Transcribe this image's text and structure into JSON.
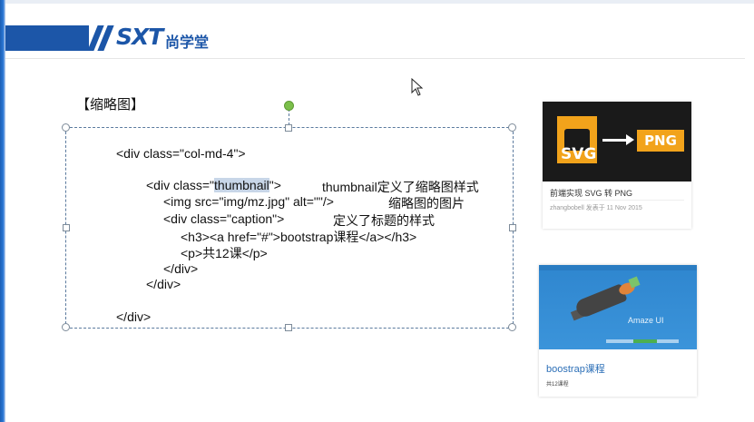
{
  "header": {
    "logo_text": "SXT",
    "logo_cn": "尚学堂"
  },
  "slide": {
    "section_title": "【缩略图】",
    "code": {
      "line1": "<div class=\"col-md-4\">",
      "line2_pre": "<div class=\"",
      "line2_hl": "thumbnail",
      "line2_post": "\">",
      "line2_note": "thumbnail定义了缩略图样式",
      "line3": "<img src=\"img/mz.jpg\" alt=\"\"/>",
      "line3_note": "缩略图的图片",
      "line4": "<div class=\"caption\">",
      "line4_note": "定义了标题的样式",
      "line5": "<h3><a href=\"#\">bootstrap课程</a></h3>",
      "line6": "<p>共12课</p>",
      "line7": "</div>",
      "line8": "</div>",
      "line9": "</div>"
    }
  },
  "cards": [
    {
      "badge_left": "SVG",
      "badge_right": "PNG",
      "title": "前端实现 SVG 转 PNG",
      "meta": "zhangbobell 发表于 11 Nov 2015"
    },
    {
      "hero_text": "Amaze UI",
      "title": "boostrap课程",
      "subtitle": "共12课程"
    }
  ],
  "colors": {
    "brand_blue": "#1c56a8",
    "selection_border": "#5b7a9e",
    "rotate_handle": "#7bbf4a",
    "accent_orange": "#f2a31b",
    "link_blue": "#2c6fb7"
  },
  "icons": {
    "cursor": "mouse-pointer-icon"
  }
}
